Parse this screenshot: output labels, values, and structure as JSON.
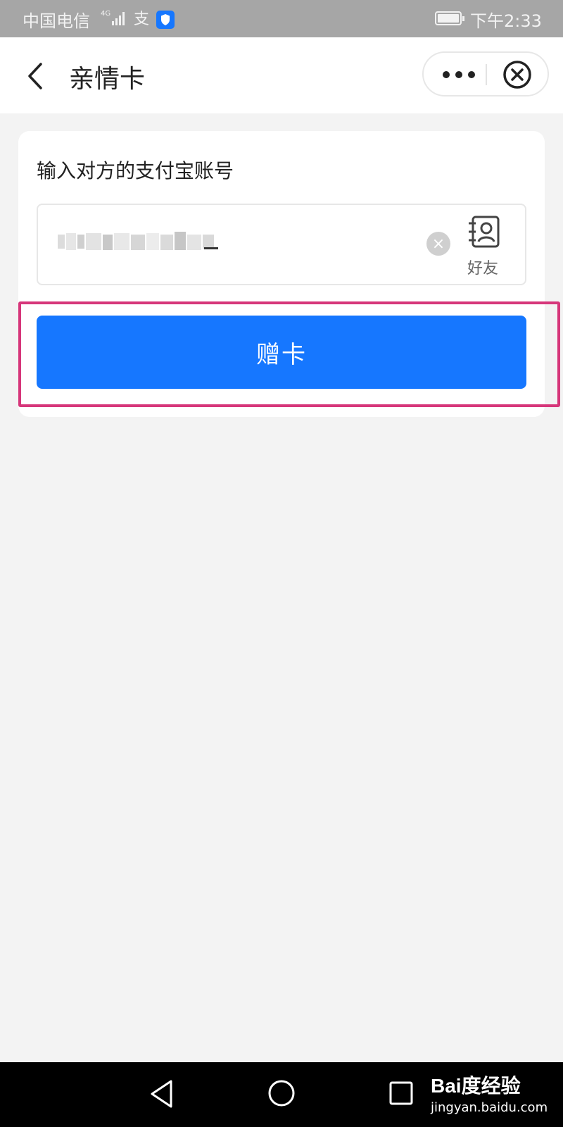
{
  "status_bar": {
    "carrier": "中国电信",
    "network": "4G",
    "app_glyph": "支",
    "time": "下午2:33"
  },
  "nav": {
    "title": "亲情卡"
  },
  "form": {
    "label": "输入对方的支付宝账号",
    "friend_label": "好友",
    "submit_label": "赠卡"
  },
  "colors": {
    "primary": "#1677ff",
    "highlight": "#d6367a"
  },
  "icons": {
    "back": "chevron-left-icon",
    "more": "more-dots-icon",
    "close": "circle-close-icon",
    "clear": "clear-input-icon",
    "contacts": "contacts-icon"
  },
  "watermark": {
    "brand": "Bai度经验",
    "url": "jingyan.baidu.com"
  }
}
